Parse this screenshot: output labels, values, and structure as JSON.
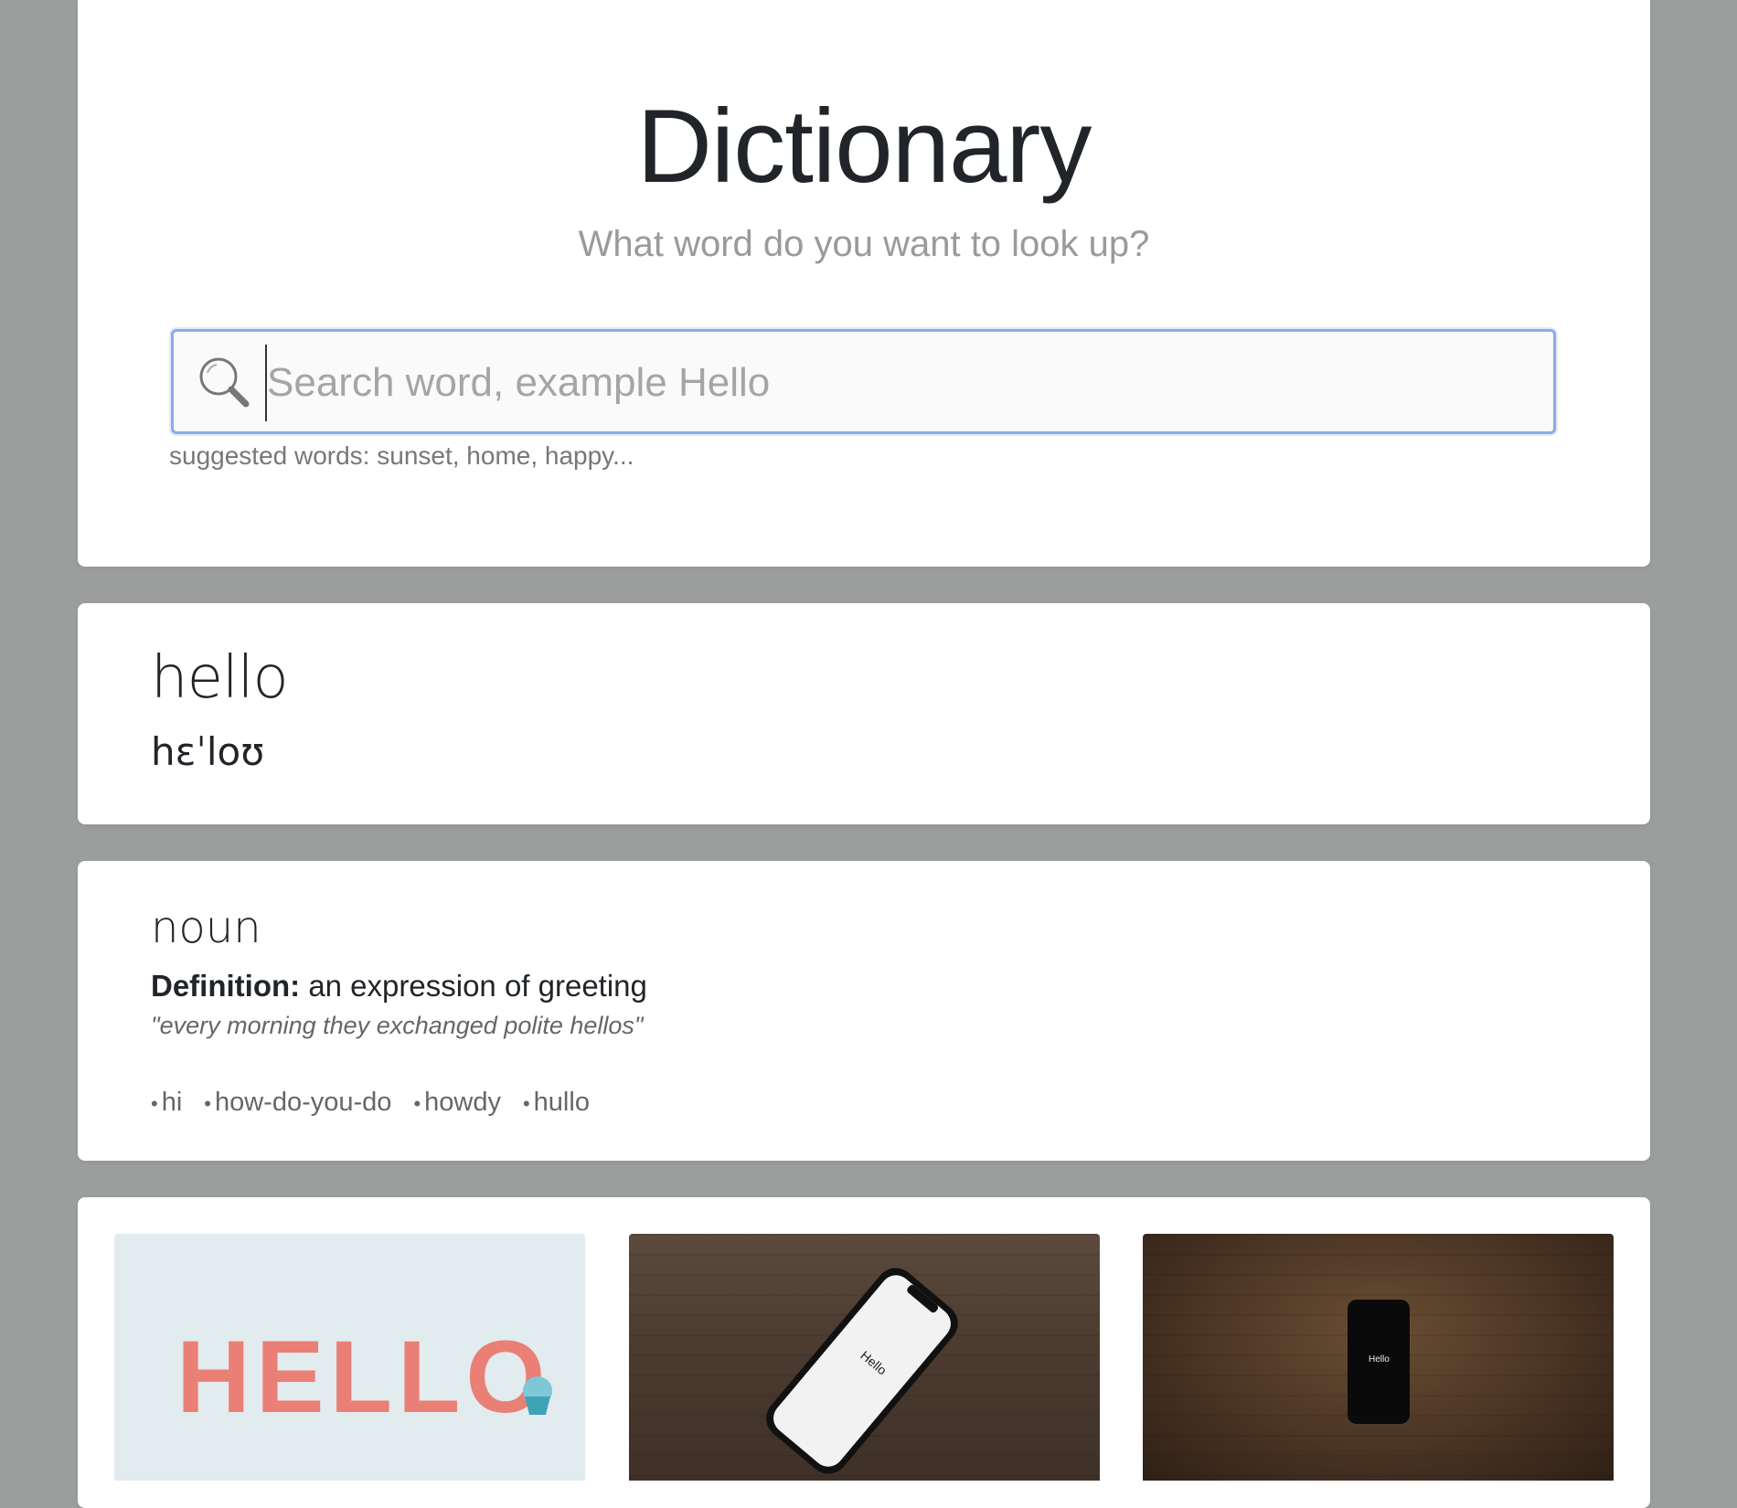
{
  "header": {
    "title": "Dictionary",
    "subtitle": "What word do you want to look up?",
    "search": {
      "value": "",
      "placeholder": "Search word, example Hello"
    },
    "suggested": "suggested words: sunset, home, happy..."
  },
  "word": {
    "text": "hello",
    "phonetic": "hɛˈloʊ"
  },
  "meaning": {
    "part_of_speech": "noun",
    "definition_label": "Definition:",
    "definition": "an expression of greeting",
    "example": "\"every morning they exchanged polite hellos\"",
    "synonyms": [
      "hi",
      "how-do-you-do",
      "howdy",
      "hullo"
    ]
  },
  "images": [
    {
      "alt": "HELLO clay letters"
    },
    {
      "alt": "Phone showing Hello on wood"
    },
    {
      "alt": "Phone showing Hello on dark wood"
    }
  ],
  "photo_text": {
    "clay": "HELLO",
    "phone_2": "Hello",
    "phone_3": "Hello"
  },
  "colors": {
    "background": "#9c9e9d",
    "card": "#ffffff",
    "search_border": "#86aee6",
    "muted_text": "#9a9a9a"
  }
}
